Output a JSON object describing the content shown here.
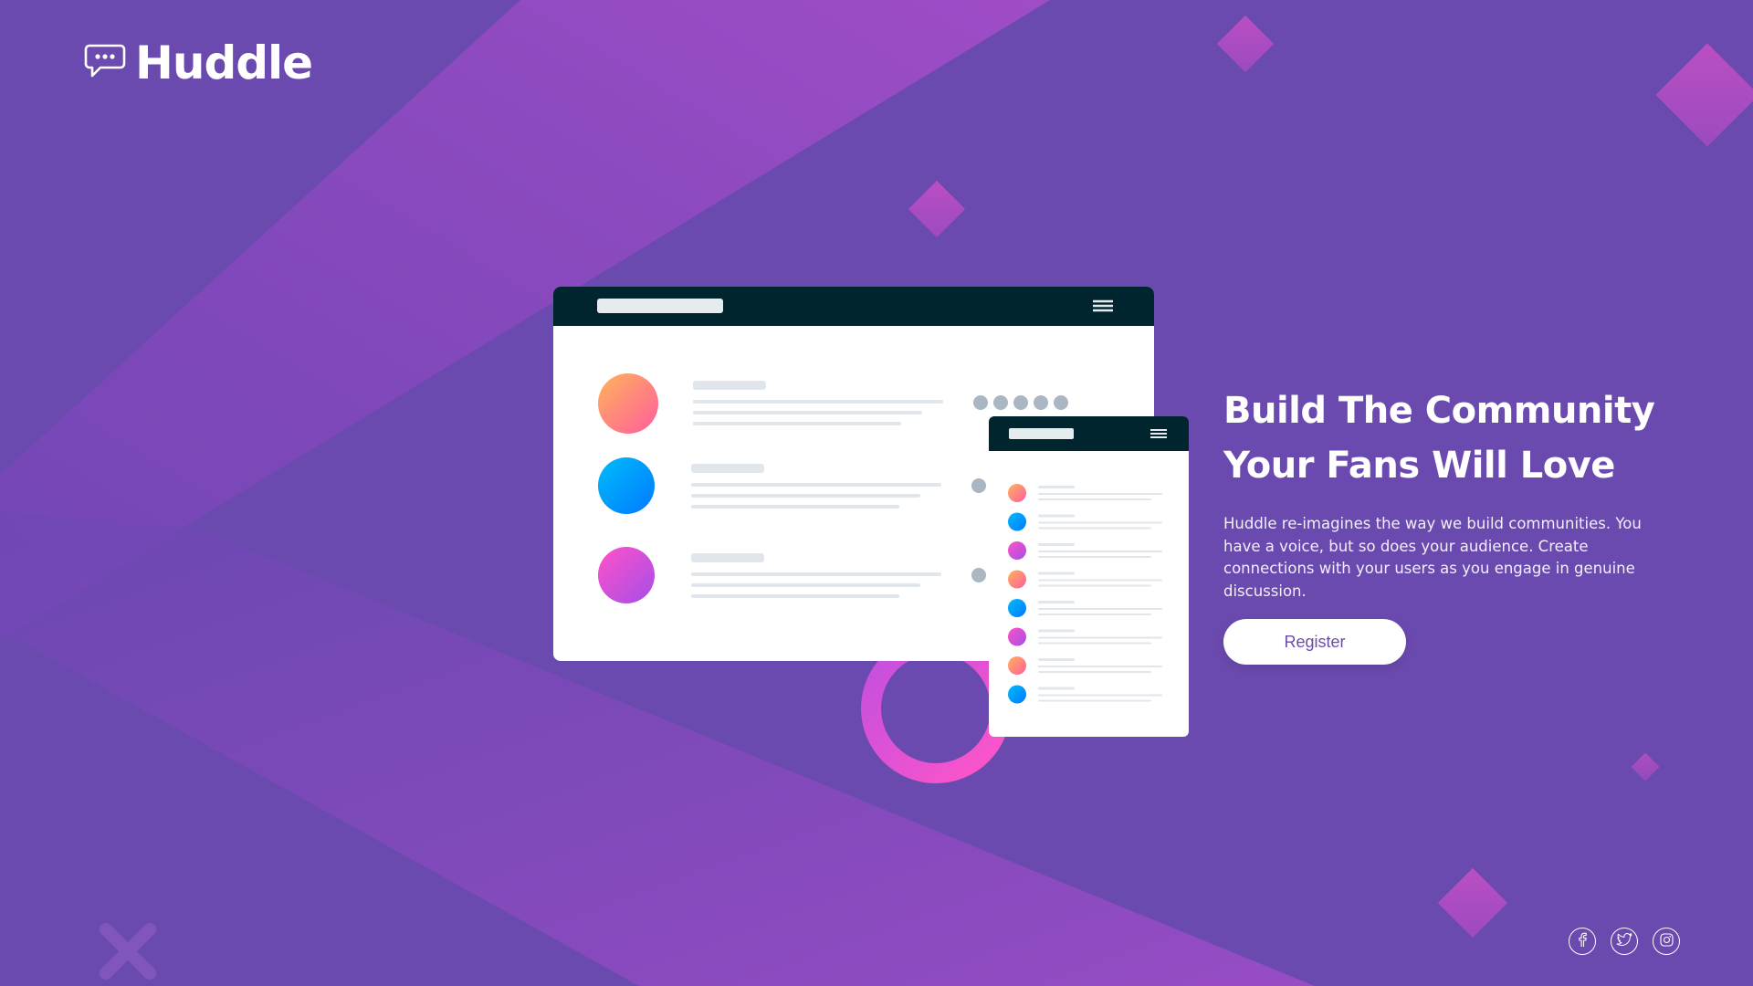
{
  "brand": {
    "name": "Huddle",
    "logo_icon": "chat-bubble-icon"
  },
  "hero": {
    "title_line1": "Build The Community",
    "title_line2": "Your Fans Will Love",
    "description": "Huddle re-imagines the way we build communities. You have a voice, but so does your audience. Create connections with your users as you engage in genuine discussion.",
    "cta_label": "Register"
  },
  "social_links": [
    {
      "icon": "facebook-icon"
    },
    {
      "icon": "twitter-icon"
    },
    {
      "icon": "instagram-icon"
    }
  ],
  "colors": {
    "background": "#6a4aae",
    "accent_pink": "#f553c9",
    "accent_purple": "#a855f7",
    "navbar_dark": "#00252e",
    "button_text": "#6a4aae"
  }
}
